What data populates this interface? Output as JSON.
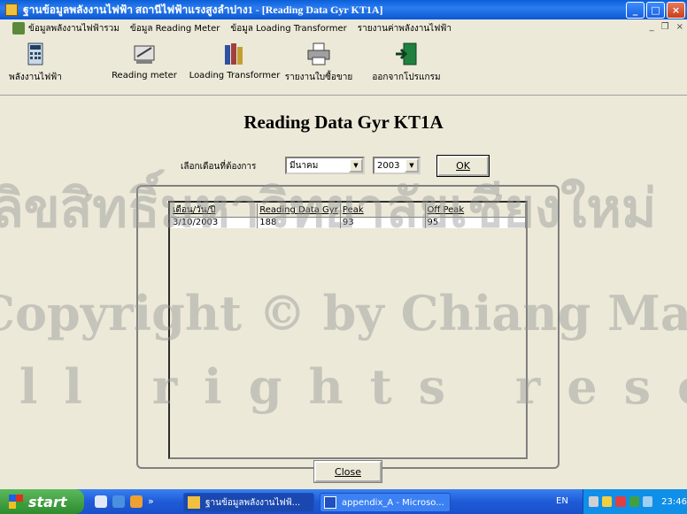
{
  "window": {
    "title": "ฐานข้อมูลพลังงานไฟฟ้า สถานีไฟฟ้าแรงสูงลำปาง1 - [Reading Data Gyr KT1A]",
    "min_glyph": "_",
    "max_glyph": "□",
    "close_glyph": "×"
  },
  "menu": {
    "items": [
      "ข้อมูลพลังงานไฟฟ้ารวม",
      "ข้อมูล Reading Meter",
      "ข้อมูล Loading Transformer",
      "รายงานค่าพลังงานไฟฟ้า"
    ],
    "mdi_min": "_",
    "mdi_restore": "❐",
    "mdi_close": "×"
  },
  "toolbar": {
    "buttons": [
      {
        "label": "พลังงานไฟฟ้า",
        "icon": "calculator-icon"
      },
      {
        "label": "Reading meter",
        "icon": "meter-icon"
      },
      {
        "label": "Loading Transformer",
        "icon": "books-icon"
      },
      {
        "label": "รายงานใบซื้อขาย",
        "icon": "printer-icon"
      },
      {
        "label": "ออกจากโปรแกรม",
        "icon": "exit-icon"
      }
    ]
  },
  "form": {
    "title": "Reading Data Gyr KT1A",
    "select_label": "เลือกเดือนที่ต้องการ",
    "month_value": "มีนาคม",
    "year_value": "2003",
    "ok_label": "OK",
    "close_label": "Close"
  },
  "grid": {
    "headers": [
      "เดือน/วัน/ปี",
      "Reading Data Gyr",
      "Peak",
      "Off Peak"
    ],
    "rows": [
      [
        "3/10/2003",
        "188",
        "93",
        "95"
      ]
    ]
  },
  "watermark": {
    "line1": "ลิขสิทธิ์มหาวิทยาลัยเชียงใหม่",
    "line2": "Copyright © by Chiang Mai University",
    "line3": "All rights reserved"
  },
  "taskbar": {
    "start_label": "start",
    "tasks": [
      "ฐานข้อมูลพลังงานไฟฟ้...",
      "appendix_A - Microso..."
    ],
    "lang": "EN",
    "clock": "23:46",
    "chevron": "»"
  },
  "colors": {
    "titlebar": "#0a5fd8",
    "face": "#ece9d8",
    "taskbar": "#1f5bd8",
    "start": "#2e8b2e"
  }
}
